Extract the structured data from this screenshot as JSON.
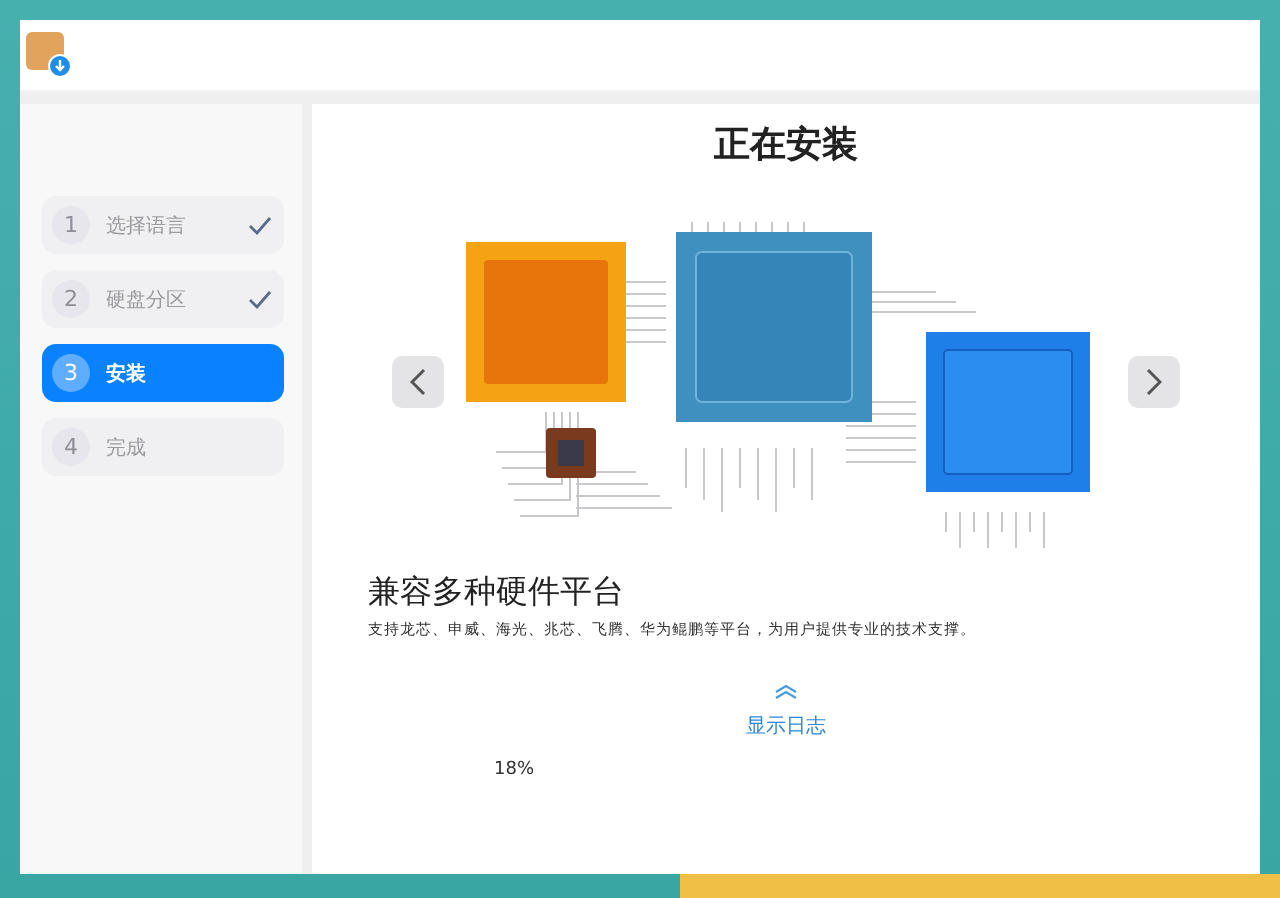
{
  "steps": [
    {
      "number": "1",
      "label": "选择语言",
      "done": true,
      "selected": false
    },
    {
      "number": "2",
      "label": "硬盘分区",
      "done": true,
      "selected": false
    },
    {
      "number": "3",
      "label": "安装",
      "done": false,
      "selected": true
    },
    {
      "number": "4",
      "label": "完成",
      "done": false,
      "selected": false
    }
  ],
  "content": {
    "title": "正在安装",
    "slide_heading": "兼容多种硬件平台",
    "slide_text": "支持龙芯、申威、海光、兆芯、飞腾、华为鲲鹏等平台，为用户提供专业的技术支撑。",
    "log_toggle": "显示日志",
    "progress": "18%"
  }
}
